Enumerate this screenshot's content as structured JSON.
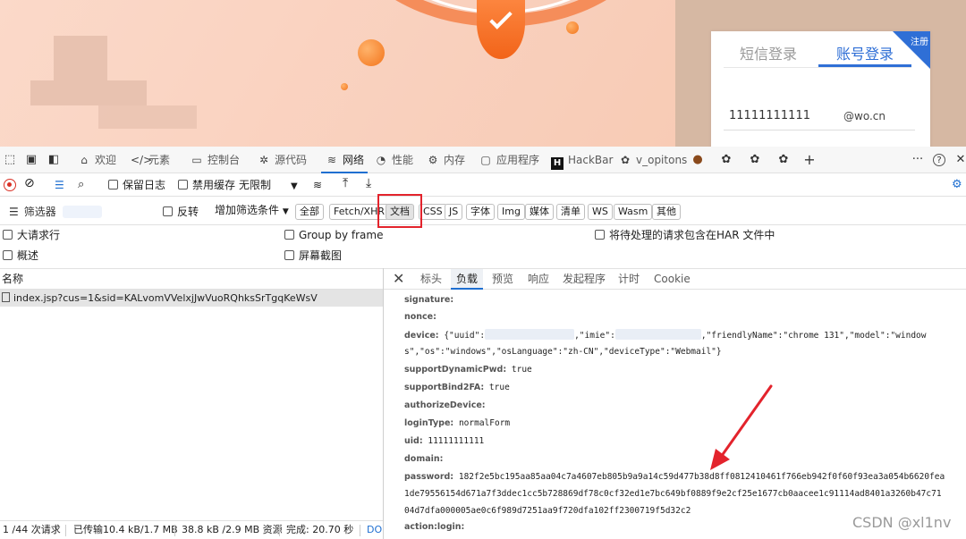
{
  "webpage": {
    "login": {
      "tab_sms": "短信登录",
      "tab_account": "账号登录",
      "ribbon": "注册",
      "username": "11111111111",
      "suffix": "@wo.cn"
    }
  },
  "devtools": {
    "tabs": [
      {
        "label": "欢迎",
        "icon": "home-icon"
      },
      {
        "label": "元素",
        "icon": "code-icon"
      },
      {
        "label": "控制台",
        "icon": "console-icon"
      },
      {
        "label": "源代码",
        "icon": "bug-icon"
      },
      {
        "label": "网络",
        "icon": "wifi-icon"
      },
      {
        "label": "性能",
        "icon": "gauge-icon"
      },
      {
        "label": "内存",
        "icon": "chip-icon"
      },
      {
        "label": "应用程序",
        "icon": "app-icon"
      },
      {
        "label": "HackBar",
        "icon": "hackbar-icon"
      },
      {
        "label": "v_opitons",
        "icon": "puzzle-icon"
      }
    ],
    "add_tab": "+",
    "more": "···",
    "help": "?",
    "close": "✕",
    "toolbar": {
      "preserve_log": "保留日志",
      "disable_cache": "禁用缓存",
      "throttle": "无限制"
    },
    "filter": {
      "placeholder": "筛选器",
      "invert": "反转",
      "more_filters": "增加筛选条件",
      "chips": [
        "全部",
        "Fetch/XHR",
        "文档",
        "CSS",
        "JS",
        "字体",
        "Img",
        "媒体",
        "清单",
        "WS",
        "Wasm",
        "其他"
      ],
      "selected_chip": "文档"
    },
    "options": {
      "big_rows": "大请求行",
      "group_by_frame": "Group by frame",
      "har_pending": "将待处理的请求包含在HAR 文件中",
      "overview": "概述",
      "screenshots": "屏幕截图"
    },
    "list_header": "名称",
    "request_name": "index.jsp?cus=1&sid=KALvomVVelxjJwVuoRQhksSrTgqKeWsV",
    "detail_tabs": [
      "标头",
      "负载",
      "预览",
      "响应",
      "发起程序",
      "计时",
      "Cookie"
    ],
    "active_detail_tab": "负载",
    "payload": {
      "signature_key": "signature:",
      "nonce_key": "nonce:",
      "device_key": "device:",
      "device_val_1a": "{\"uuid\":",
      "device_val_1b": ",\"imie\":",
      "device_val_1c": ",\"friendlyName\":\"chrome 131\",\"model\":\"window",
      "device_val_2": "s\",\"os\":\"windows\",\"osLanguage\":\"zh-CN\",\"deviceType\":\"Webmail\"}",
      "support_pwd_key": "supportDynamicPwd:",
      "support_pwd_val": "true",
      "support_2fa_key": "supportBind2FA:",
      "support_2fa_val": "true",
      "authorize_key": "authorizeDevice:",
      "login_type_key": "loginType:",
      "login_type_val": "normalForm",
      "uid_key": "uid:",
      "uid_val": "11111111111",
      "domain_key": "domain:",
      "password_key": "password:",
      "password_1": "182f2e5bc195aa85aa04c7a4607eb805b9a9a14c59d477b38d8ff0812410461f766eb942f0f60f93ea3a054b6620fea",
      "password_2": "1de79556154d671a7f3ddec1cc5b728869df78c0cf32ed1e7bc649bf0889f9e2cf25e1677cb0aacee1c91114ad8401a3260b47c71",
      "password_3": "04d7dfa000005ae0c6f989d7251aa9f720dfa102ff2300719f5d32c2",
      "action_key": "action:login:"
    },
    "status": {
      "requests": "1 /44 次请求",
      "transferred": "已传输10.4 kB/1.7 MB",
      "resources": "38.8 kB /2.9 MB 资源",
      "finish": "完成: 20.70 秒",
      "dom": "DOM"
    },
    "watermark": "CSDN @xl1nv"
  },
  "colors": {
    "accent": "#1f6fd1",
    "highlight_box": "#e3232c",
    "annotation_arrow": "#e3232c",
    "login_blue": "#2f6fd6"
  }
}
